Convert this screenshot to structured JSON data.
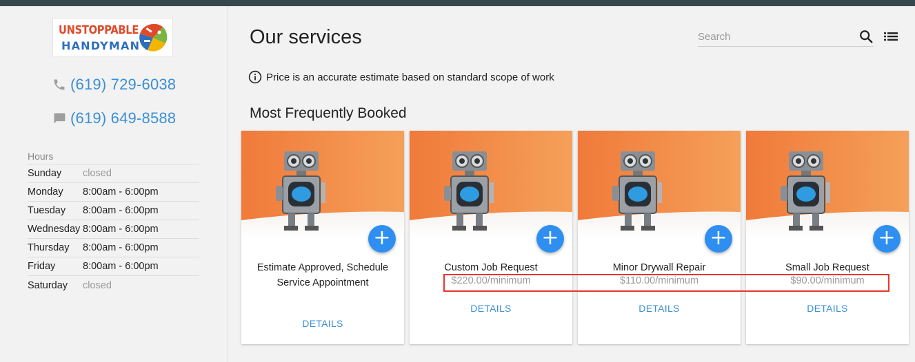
{
  "logo": {
    "line1": "UNSTOPPABLE",
    "line2": "HANDYMAN"
  },
  "contact": {
    "phone": {
      "icon": "phone-icon",
      "number": "(619) 729-6038"
    },
    "sms": {
      "icon": "message-icon",
      "number": "(619) 649-8588"
    }
  },
  "hours": {
    "title": "Hours",
    "rows": [
      {
        "day": "Sunday",
        "time": "closed"
      },
      {
        "day": "Monday",
        "time": "8:00am - 6:00pm"
      },
      {
        "day": "Tuesday",
        "time": "8:00am - 6:00pm"
      },
      {
        "day": "Wednesday",
        "time": "8:00am - 6:00pm"
      },
      {
        "day": "Thursday",
        "time": "8:00am - 6:00pm"
      },
      {
        "day": "Friday",
        "time": "8:00am - 6:00pm"
      },
      {
        "day": "Saturday",
        "time": "closed"
      }
    ]
  },
  "main": {
    "title": "Our services",
    "search": {
      "placeholder": "Search"
    },
    "notice": "Price is an accurate estimate based on standard scope of work",
    "section_title": "Most Frequently Booked",
    "cards": [
      {
        "title": "Estimate Approved, Schedule Service Appointment",
        "price": "",
        "details": "DETAILS",
        "add": "+"
      },
      {
        "title": "Custom Job Request",
        "price": "$220.00/minimum",
        "details": "DETAILS",
        "add": "+"
      },
      {
        "title": "Minor Drywall Repair",
        "price": "$110.00/minimum",
        "details": "DETAILS",
        "add": "+"
      },
      {
        "title": "Small Job Request",
        "price": "$90.00/minimum",
        "details": "DETAILS",
        "add": "+"
      }
    ]
  },
  "colors": {
    "accent": "#2f8ff0",
    "link": "#3a8fd6",
    "highlight": "#e8352a",
    "topbar": "#37474f"
  }
}
